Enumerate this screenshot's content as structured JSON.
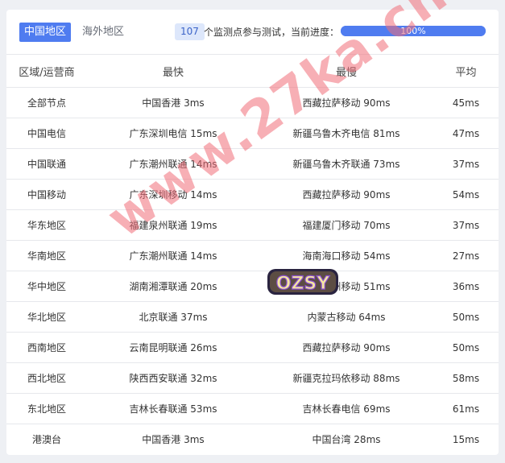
{
  "tabs": {
    "active": "中国地区",
    "inactive": "海外地区"
  },
  "status": {
    "count": "107",
    "text": "个监测点参与测试，当前进度：",
    "progress_percent": 100,
    "progress_label": "100%"
  },
  "table": {
    "headers": {
      "region": "区域/运营商",
      "fastest": "最快",
      "slowest": "最慢",
      "average": "平均"
    },
    "rows": [
      {
        "region": "全部节点",
        "fastest": "中国香港 3ms",
        "slowest": "西藏拉萨移动 90ms",
        "average": "45ms"
      },
      {
        "region": "中国电信",
        "fastest": "广东深圳电信 15ms",
        "slowest": "新疆乌鲁木齐电信 81ms",
        "average": "47ms"
      },
      {
        "region": "中国联通",
        "fastest": "广东潮州联通 14ms",
        "slowest": "新疆乌鲁木齐联通 73ms",
        "average": "37ms"
      },
      {
        "region": "中国移动",
        "fastest": "广东深圳移动 14ms",
        "slowest": "西藏拉萨移动 90ms",
        "average": "54ms"
      },
      {
        "region": "华东地区",
        "fastest": "福建泉州联通 19ms",
        "slowest": "福建厦门移动 70ms",
        "average": "37ms"
      },
      {
        "region": "华南地区",
        "fastest": "广东潮州联通 14ms",
        "slowest": "海南海口移动 54ms",
        "average": "27ms"
      },
      {
        "region": "华中地区",
        "fastest": "湖南湘潭联通 20ms",
        "slowest": "湖北荆州移动 51ms",
        "average": "36ms"
      },
      {
        "region": "华北地区",
        "fastest": "北京联通 37ms",
        "slowest": "内蒙古移动 64ms",
        "average": "50ms"
      },
      {
        "region": "西南地区",
        "fastest": "云南昆明联通 26ms",
        "slowest": "西藏拉萨移动 90ms",
        "average": "50ms"
      },
      {
        "region": "西北地区",
        "fastest": "陕西西安联通 32ms",
        "slowest": "新疆克拉玛依移动 88ms",
        "average": "58ms"
      },
      {
        "region": "东北地区",
        "fastest": "吉林长春联通 53ms",
        "slowest": "吉林长春电信 69ms",
        "average": "61ms"
      },
      {
        "region": "港澳台",
        "fastest": "中国香港 3ms",
        "slowest": "中国台湾 28ms",
        "average": "15ms"
      }
    ]
  },
  "overlays": {
    "watermark": "www.27ka.cn",
    "logo": "OZSY"
  },
  "colors": {
    "accent": "#4f7cf0",
    "badge_bg": "#dde7fb",
    "watermark": "#f06e78"
  }
}
